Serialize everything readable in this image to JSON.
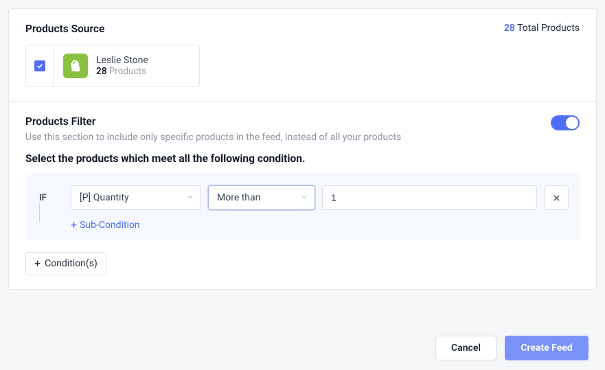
{
  "source": {
    "title": "Products Source",
    "total_count": "28",
    "total_label": " Total Products",
    "store_name": "Leslie Stone",
    "store_count": "28",
    "store_products_label": " Products"
  },
  "filter": {
    "title": "Products Filter",
    "description": "Use this section to include only specific products in the feed, instead of all your products",
    "instruction": "Select the products which meet all the following condition.",
    "if_label": "IF",
    "field": "[P] Quantity",
    "operator": "More than",
    "value": "1",
    "sub_condition_label": "Sub-Condition",
    "add_condition_label": "Condition(s)"
  },
  "footer": {
    "cancel": "Cancel",
    "create": "Create Feed"
  }
}
